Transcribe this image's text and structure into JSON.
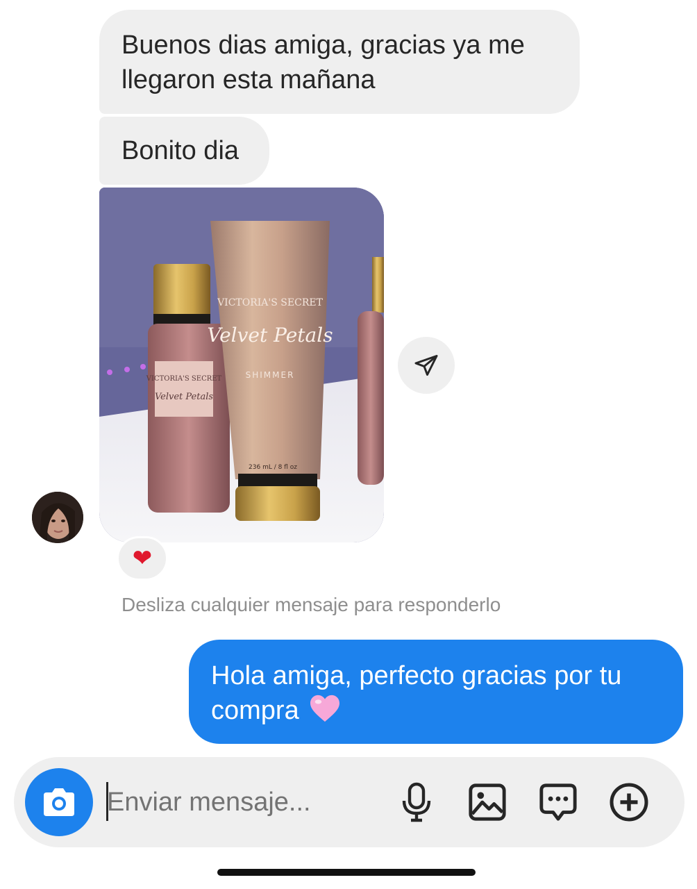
{
  "messages": {
    "received_1": "Buenos dias amiga, gracias ya me llegaron esta mañana",
    "received_2": "Bonito dia",
    "photo": {
      "labels": [
        "VICTORIA'S SECRET",
        "Velvet Petals",
        "SHIMMER",
        "236 mL / 8 fl oz"
      ]
    },
    "reaction": "❤",
    "hint": "Desliza cualquier mensaje para responderlo",
    "sent_1": "Hola amiga, perfecto gracias por tu compra"
  },
  "composer": {
    "placeholder": "Enviar mensaje..."
  },
  "icons": {
    "share": "paper-plane-icon",
    "camera": "camera-icon",
    "mic": "microphone-icon",
    "gallery": "image-icon",
    "sticker": "chat-bubble-icon",
    "plus": "plus-circle-icon",
    "heart_reaction": "red-heart-icon",
    "heart_emoji": "pink-heart-icon"
  },
  "colors": {
    "received_bubble": "#efefef",
    "sent_bubble": "#1d82ed",
    "reaction_heart": "#e0182d",
    "pink_heart": "#f7a8d8"
  }
}
